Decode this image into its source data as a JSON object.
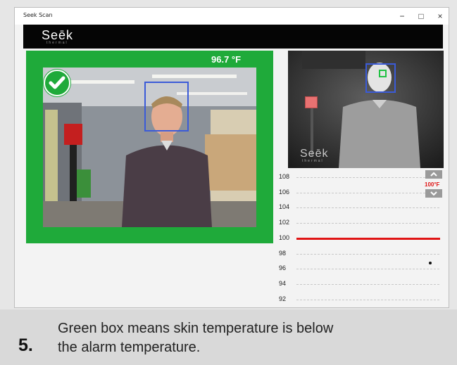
{
  "window": {
    "title": "Seek Scan",
    "controls": [
      "−",
      "□",
      "×"
    ]
  },
  "header": {
    "logo_text": "Seēk",
    "logo_subtext": "thermal"
  },
  "camera": {
    "temperature": "96.7 °F",
    "status_color": "#1faa3a",
    "status_icon": "check-icon",
    "face_box_color": "#3b5bd8"
  },
  "thermal": {
    "logo_text": "Seēk",
    "logo_subtext": "thermal"
  },
  "graph": {
    "ticks": [
      "108",
      "106",
      "104",
      "102",
      "100",
      "98",
      "96",
      "94",
      "92"
    ],
    "alarm_label": "100°F",
    "alarm_value": 100,
    "reading_value": 96.7
  },
  "caption": {
    "step": "5.",
    "line1": "Green box means skin temperature is below",
    "line2": "the alarm temperature."
  }
}
